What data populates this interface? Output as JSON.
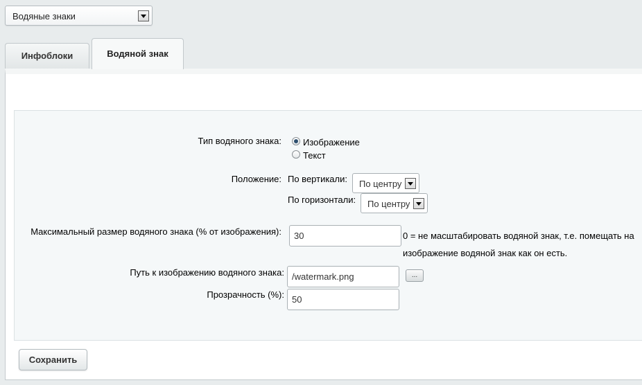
{
  "top_select": {
    "value": "Водяные знаки"
  },
  "tabs": [
    {
      "label": "Инфоблоки",
      "active": false
    },
    {
      "label": "Водяной знак",
      "active": true
    }
  ],
  "form": {
    "type_label": "Тип водяного знака:",
    "type_options": [
      {
        "label": "Изображение",
        "checked": true
      },
      {
        "label": "Текст",
        "checked": false
      }
    ],
    "position_label": "Положение:",
    "vertical_label": "По вертикали:",
    "vertical_value": "По центру",
    "horizontal_label": "По горизонтали:",
    "horizontal_value": "По центру",
    "max_size_label": "Максимальный размер водяного знака (% от изображения):",
    "max_size_value": "30",
    "max_size_hint_line1": "0 = не масштабировать водяной знак, т.е. помещать на",
    "max_size_hint_line2": "изображение водяной знак как он есть.",
    "path_label": "Путь к изображению водяного знака:",
    "path_value": "/watermark.png",
    "browse_label": "...",
    "opacity_label": "Прозрачность (%):",
    "opacity_value": "50"
  },
  "save_label": "Сохранить"
}
